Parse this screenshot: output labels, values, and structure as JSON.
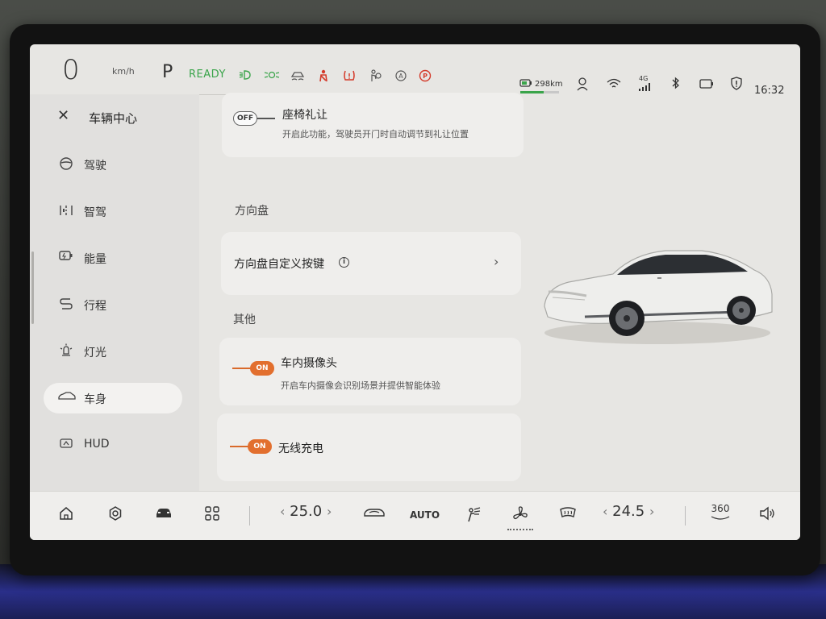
{
  "status": {
    "speed": "0",
    "speed_unit": "km/h",
    "gear": "P",
    "ready": "READY",
    "range": "298km",
    "range_fraction": 0.6,
    "network": "4G",
    "time": "16:32"
  },
  "sidebar": {
    "title": "车辆中心",
    "items": [
      {
        "label": "驾驶",
        "icon": "steering-wheel-icon"
      },
      {
        "label": "智驾",
        "icon": "assisted-driving-icon"
      },
      {
        "label": "能量",
        "icon": "battery-icon"
      },
      {
        "label": "行程",
        "icon": "route-icon"
      },
      {
        "label": "灯光",
        "icon": "light-icon"
      },
      {
        "label": "车身",
        "icon": "car-body-icon",
        "active": true
      },
      {
        "label": "HUD",
        "icon": "hud-icon"
      }
    ]
  },
  "settings": {
    "seat_courtesy": {
      "title": "座椅礼让",
      "desc": "开启此功能，驾驶员开门时自动调节到礼让位置",
      "toggle": "OFF"
    },
    "steering_section": "方向盘",
    "steering_custom": {
      "title": "方向盘自定义按键",
      "info": "i",
      "chevron": "›"
    },
    "other_section": "其他",
    "cabin_camera": {
      "title": "车内摄像头",
      "desc": "开启车内摄像会识别场景并提供智能体验",
      "toggle": "ON"
    },
    "wireless_charge": {
      "title": "无线充电",
      "toggle": "ON"
    }
  },
  "dock": {
    "driver_temp": "25.0",
    "passenger_temp": "24.5",
    "temp_left_arrow": "‹",
    "temp_right_arrow": "›",
    "auto": "AUTO",
    "view_360": "360"
  },
  "colors": {
    "accent_on": "#e26f2e",
    "ready_green": "#3aa44a",
    "warning_red": "#d43a2a"
  }
}
